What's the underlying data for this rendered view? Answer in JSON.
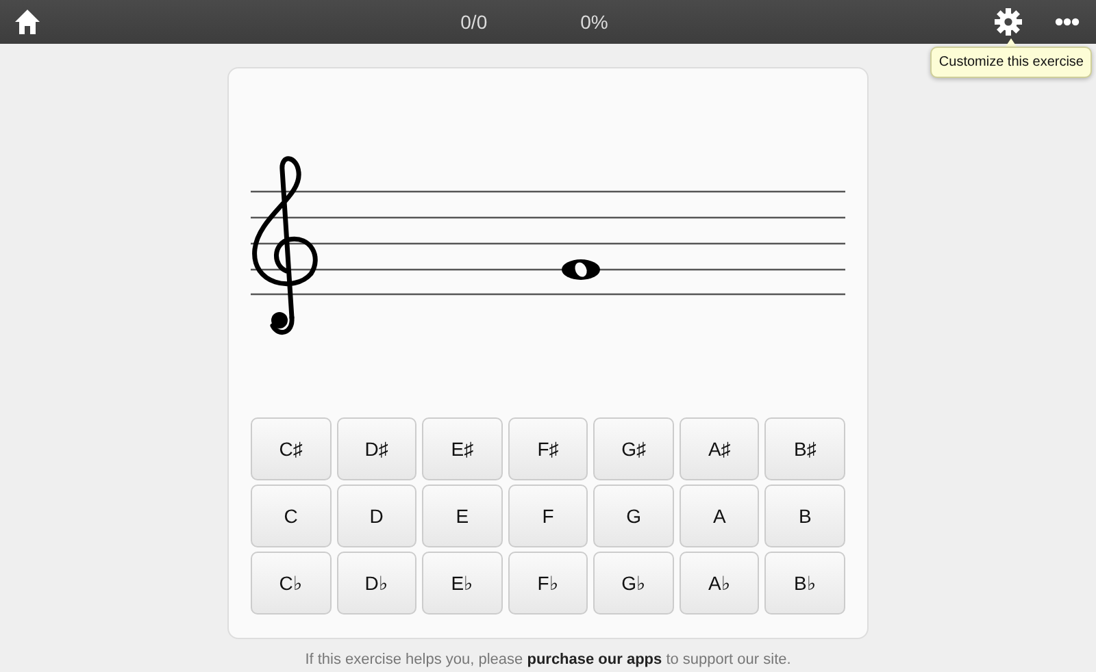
{
  "top_bar": {
    "score": "0/0",
    "percent": "0%",
    "tooltip": "Customize this exercise"
  },
  "answer_rows": [
    [
      "C♯",
      "D♯",
      "E♯",
      "F♯",
      "G♯",
      "A♯",
      "B♯"
    ],
    [
      "C",
      "D",
      "E",
      "F",
      "G",
      "A",
      "B"
    ],
    [
      "C♭",
      "D♭",
      "E♭",
      "F♭",
      "G♭",
      "A♭",
      "B♭"
    ]
  ],
  "footer": "If this exercise helps you, please **purchase our apps** to support our site."
}
